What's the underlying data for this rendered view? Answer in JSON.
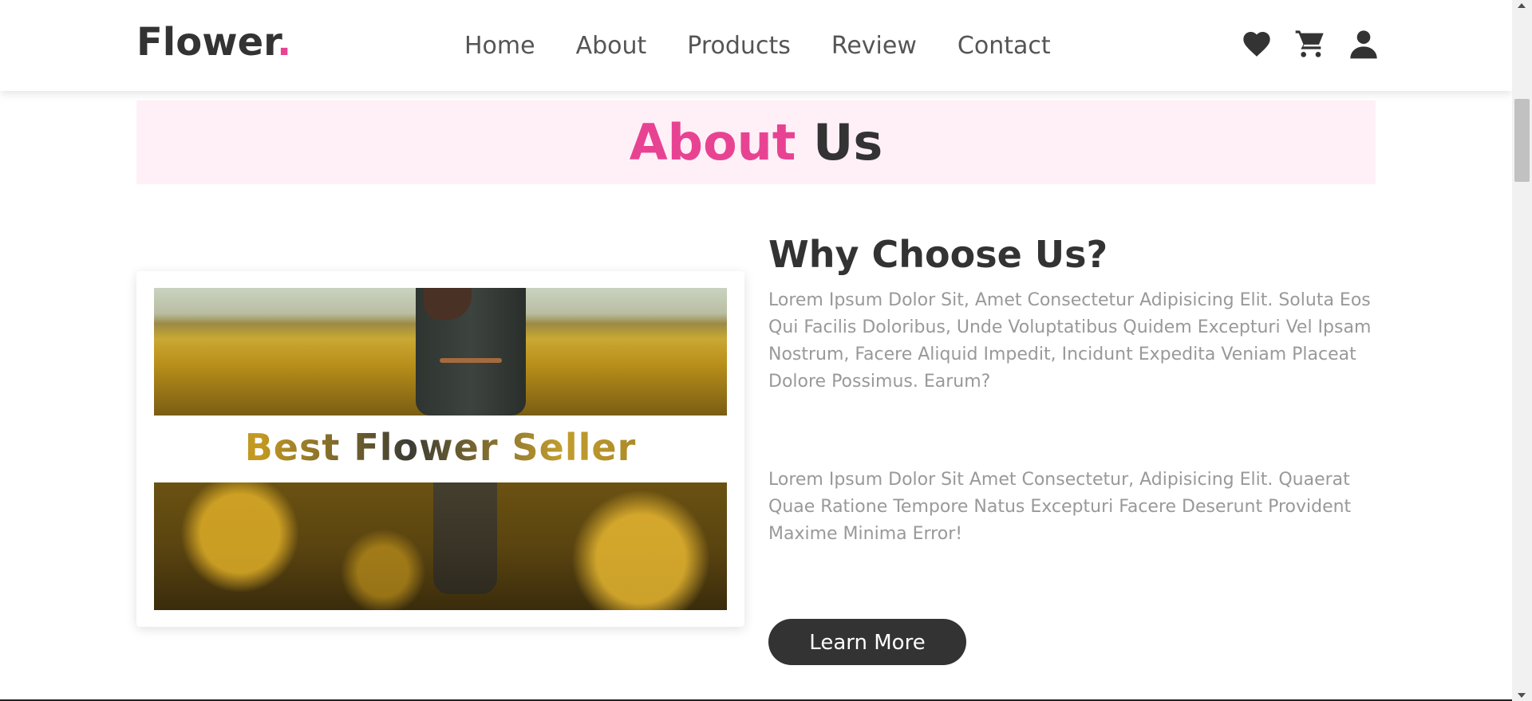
{
  "header": {
    "logo_text": "Flower",
    "logo_dot": ".",
    "nav": [
      "Home",
      "About",
      "Products",
      "Review",
      "Contact"
    ],
    "icons": [
      "heart-icon",
      "cart-icon",
      "user-icon"
    ]
  },
  "section": {
    "heading_accent": "About",
    "heading_rest": " Us"
  },
  "card": {
    "title": "Best Flower Seller"
  },
  "content": {
    "heading": "Why Choose Us?",
    "paragraph1": "Lorem Ipsum Dolor Sit, Amet Consectetur Adipisicing Elit. Soluta Eos Qui Facilis Doloribus, Unde Voluptatibus Quidem Excepturi Vel Ipsam Nostrum, Facere Aliquid Impedit, Incidunt Expedita Veniam Placeat Dolore Possimus. Earum?",
    "paragraph2": "Lorem Ipsum Dolor Sit Amet Consectetur, Adipisicing Elit. Quaerat Quae Ratione Tempore Natus Excepturi Facere Deserunt Provident Maxime Minima Error!",
    "button": "Learn More"
  },
  "colors": {
    "accent": "#e84393",
    "dark": "#333333",
    "band_bg": "#fff0f8",
    "muted_text": "#999999"
  }
}
